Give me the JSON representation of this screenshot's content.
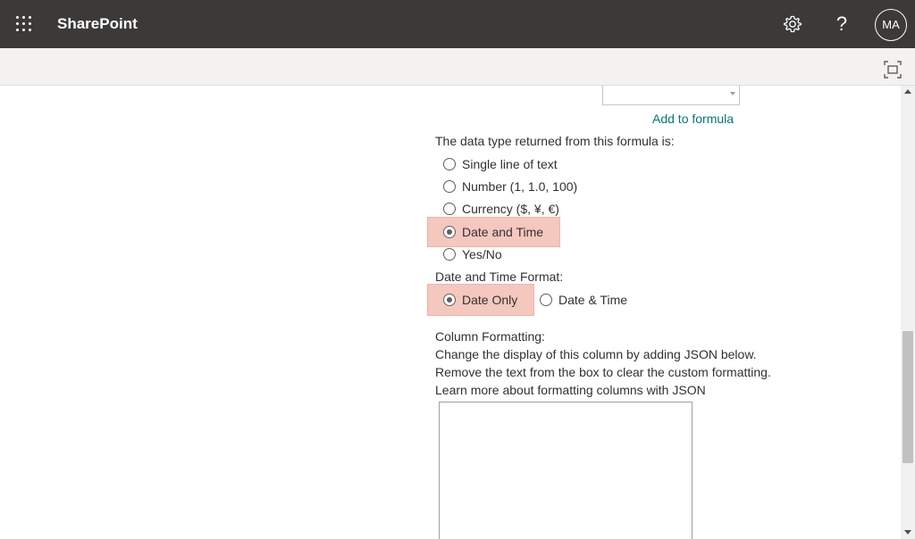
{
  "suite_bar": {
    "app_name": "SharePoint",
    "help_label": "?",
    "avatar_initials": "MA",
    "background": "#3b3a39"
  },
  "form": {
    "add_to_formula": "Add to formula",
    "data_type_label": "The data type returned from this formula is:",
    "data_type_options": [
      {
        "label": "Single line of text",
        "selected": false
      },
      {
        "label": "Number (1, 1.0, 100)",
        "selected": false
      },
      {
        "label": "Currency ($, ¥, €)",
        "selected": false
      },
      {
        "label": "Date and Time",
        "selected": true
      },
      {
        "label": "Yes/No",
        "selected": false
      }
    ],
    "date_format_label": "Date and Time Format:",
    "date_format_options": [
      {
        "label": "Date Only",
        "selected": true
      },
      {
        "label": "Date & Time",
        "selected": false
      }
    ],
    "column_formatting": {
      "heading": "Column Formatting:",
      "line1": "Change the display of this column by adding JSON below.",
      "line2": "Remove the text from the box to clear the custom formatting.",
      "learn_more": "Learn more about formatting columns with JSON",
      "json_value": ""
    }
  },
  "colors": {
    "link": "#03787c",
    "highlight": "#f4c7bf"
  },
  "icons": [
    "waffle-icon",
    "gear-icon",
    "help-icon",
    "focus-mode-icon"
  ]
}
